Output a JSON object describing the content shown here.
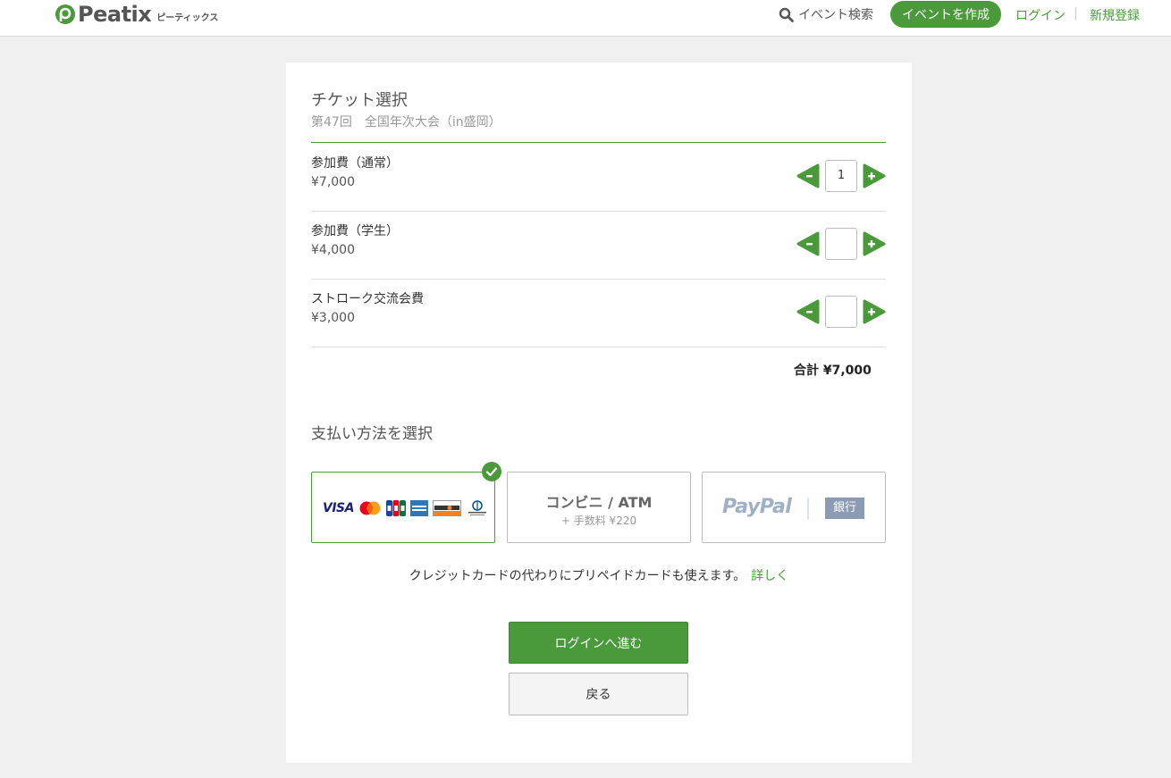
{
  "header": {
    "logo_word": "Peatix",
    "logo_kana": "ピーティックス",
    "search_label": "イベント検索",
    "create_label": "イベントを作成",
    "login_label": "ログイン",
    "separator": "|",
    "signup_label": "新規登録"
  },
  "ticket_section": {
    "title": "チケット選択",
    "event_name": "第47回　全国年次大会（in盛岡）",
    "tickets": [
      {
        "name": "参加費（通常）",
        "price": "¥7,000",
        "quantity": "1"
      },
      {
        "name": "参加費（学生）",
        "price": "¥4,000",
        "quantity": ""
      },
      {
        "name": "ストローク交流会費",
        "price": "¥3,000",
        "quantity": ""
      }
    ],
    "total": "合計 ¥7,000"
  },
  "payment": {
    "title": "支払い方法を選択",
    "card_brands": [
      "VISA",
      "Mastercard",
      "JCB",
      "American Express",
      "DISCOVER",
      "Diners Club"
    ],
    "visa_text": "VISA",
    "convenience_title": "コンビニ / ATM",
    "convenience_fee": "+ 手数料 ¥220",
    "paypal_text": "PayPal",
    "bank_text": "銀行",
    "selected": "card"
  },
  "note": {
    "text": "クレジットカードの代わりにプリペイドカードも使えます。",
    "more_link": "詳しく"
  },
  "actions": {
    "proceed_label": "ログインへ進む",
    "back_label": "戻る"
  },
  "colors": {
    "brand_green": "#4a9a3c",
    "background": "#f0f0f0"
  }
}
